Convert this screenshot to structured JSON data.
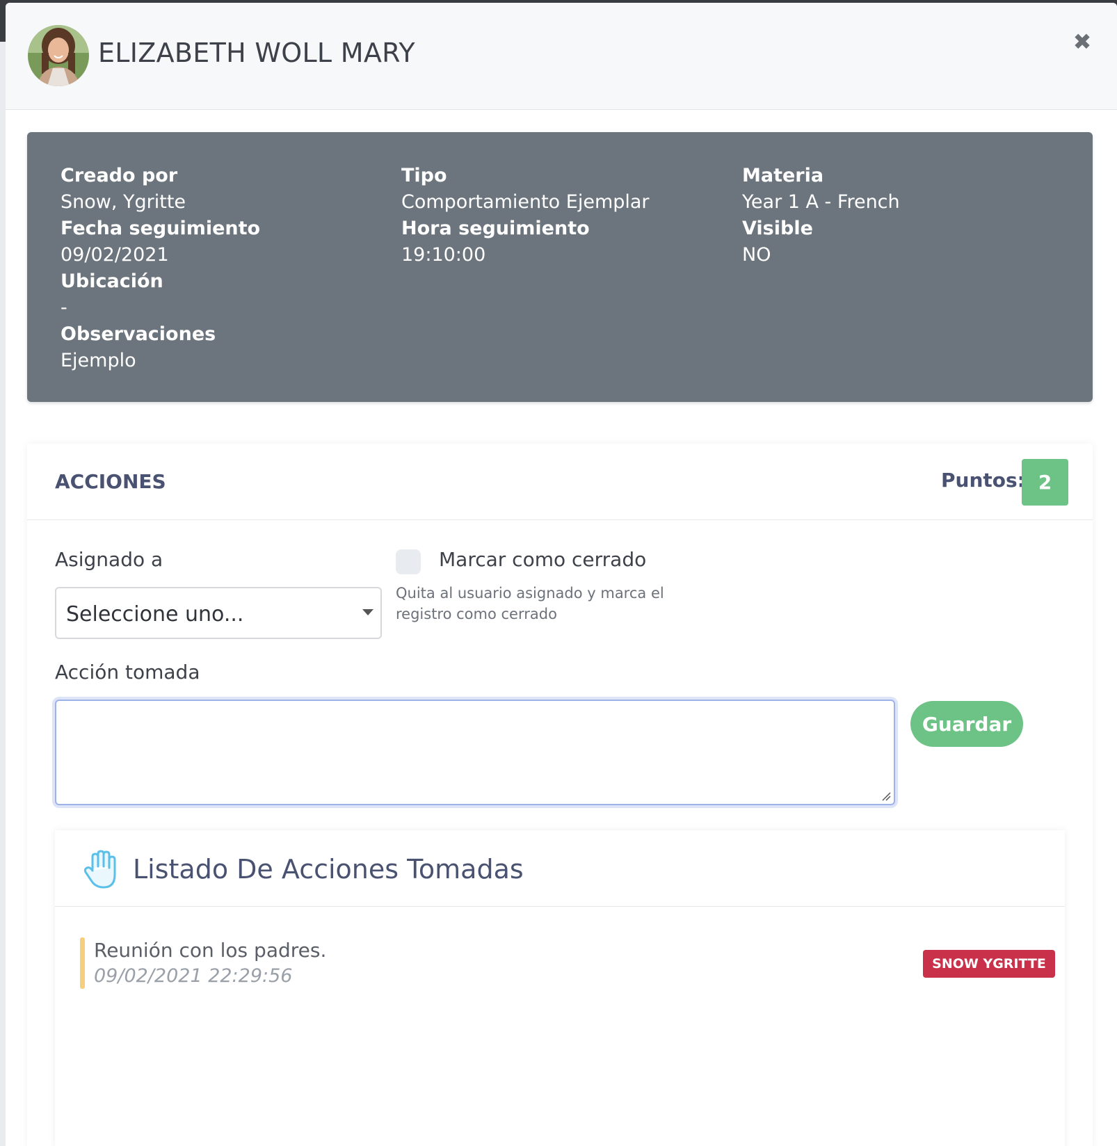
{
  "modal": {
    "title": "ELIZABETH WOLL MARY",
    "close_icon": "close-icon"
  },
  "info": {
    "col1": [
      {
        "label": "Creado por",
        "value": "Snow, Ygritte"
      },
      {
        "label": "Fecha seguimiento",
        "value": "09/02/2021"
      },
      {
        "label": "Ubicación",
        "value": "-"
      },
      {
        "label": "Observaciones",
        "value": "Ejemplo"
      }
    ],
    "col2": [
      {
        "label": "Tipo",
        "value": "Comportamiento Ejemplar"
      },
      {
        "label": "Hora seguimiento",
        "value": "19:10:00"
      }
    ],
    "col3": [
      {
        "label": "Materia",
        "value": "Year 1 A - French"
      },
      {
        "label": "Visible",
        "value": "NO"
      }
    ]
  },
  "actions": {
    "title": "ACCIONES",
    "points_label": "Puntos:",
    "points_value": "2",
    "assigned_label": "Asignado a",
    "assigned_value": "Seleccione uno...",
    "close_checkbox_label": "Marcar como cerrado",
    "close_checkbox_checked": false,
    "close_help": "Quita al usuario asignado y marca el registro como cerrado",
    "action_taken_label": "Acción tomada",
    "action_taken_value": "",
    "save_label": "Guardar"
  },
  "list": {
    "icon": "hand-icon",
    "title": "Listado De Acciones Tomadas",
    "items": [
      {
        "text": "Reunión con los padres.",
        "date": "09/02/2021 22:29:56",
        "user": "SNOW YGRITTE"
      }
    ]
  },
  "colors": {
    "info_bg": "#6c757d",
    "success": "#6cc385",
    "danger": "#c9304a",
    "warning_bar": "#f6cf7e",
    "heading": "#495270"
  }
}
